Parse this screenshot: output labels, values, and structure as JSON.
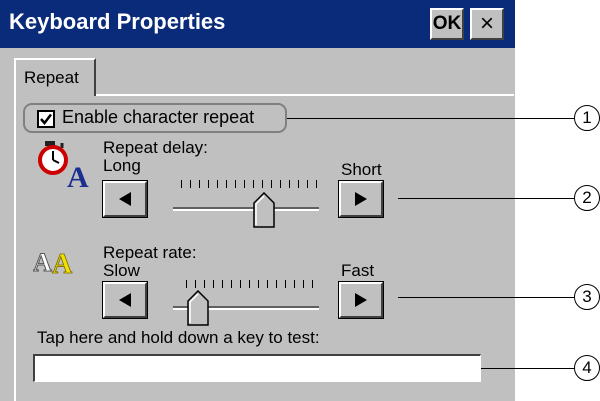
{
  "window": {
    "title": "Keyboard Properties",
    "ok_label": "OK",
    "close_label": "×"
  },
  "tabs": [
    {
      "label": "Repeat",
      "selected": true
    }
  ],
  "repeat": {
    "enable_label": "Enable character repeat",
    "enabled": true,
    "delay": {
      "title": "Repeat delay:",
      "min_label": "Long",
      "max_label": "Short",
      "level": 0.63
    },
    "rate": {
      "title": "Repeat rate:",
      "min_label": "Slow",
      "max_label": "Fast",
      "level": 0.16
    },
    "test_label": "Tap here and hold down a key to test:",
    "test_value": ""
  },
  "callouts": [
    "1",
    "2",
    "3",
    "4"
  ],
  "icons": {
    "delay": "stopwatch-letter-a-icon",
    "rate": "double-letter-a-icon",
    "left": "arrow-left-icon",
    "right": "arrow-right-icon"
  }
}
